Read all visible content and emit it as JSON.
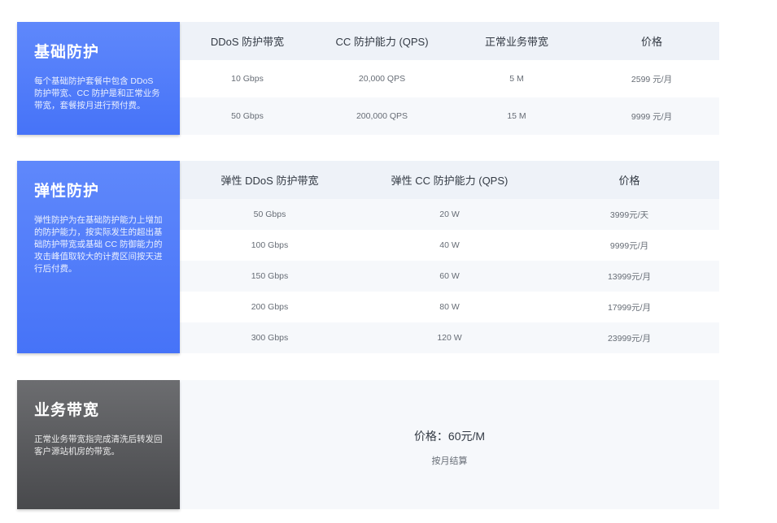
{
  "basic": {
    "title": "基础防护",
    "desc": "每个基础防护套餐中包含 DDoS 防护带宽、CC 防护是和正常业务带宽，套餐按月进行预付费。",
    "headers": [
      "DDoS 防护带宽",
      "CC 防护能力 (QPS)",
      "正常业务带宽",
      "价格"
    ],
    "rows": [
      [
        "10 Gbps",
        "20,000 QPS",
        "5 M",
        "2599 元/月"
      ],
      [
        "50 Gbps",
        "200,000 QPS",
        "15 M",
        "9999 元/月"
      ]
    ]
  },
  "elastic": {
    "title": "弹性防护",
    "desc": "弹性防护为在基础防护能力上增加的防护能力，按实际发生的超出基础防护带宽或基础 CC 防御能力的攻击峰值取较大的计费区间按天进行后付费。",
    "headers": [
      "弹性 DDoS 防护带宽",
      "弹性 CC 防护能力 (QPS)",
      "价格"
    ],
    "rows": [
      [
        "50 Gbps",
        "20 W",
        "3999元/天"
      ],
      [
        "100 Gbps",
        "40 W",
        "9999元/月"
      ],
      [
        "150 Gbps",
        "60 W",
        "13999元/月"
      ],
      [
        "200 Gbps",
        "80 W",
        "17999元/月"
      ],
      [
        "300 Gbps",
        "120 W",
        "23999元/月"
      ]
    ]
  },
  "bandwidth": {
    "title": "业务带宽",
    "desc": "正常业务带宽指完成清洗后转发回客户源站机房的带宽。",
    "price": "价格：60元/M",
    "billing": "按月结算"
  },
  "colors": {
    "accent_blue": "#4673f8",
    "side_gray": "#48494c",
    "header_bg": "#eef2f8",
    "stripe_bg": "#f6f8fb"
  }
}
